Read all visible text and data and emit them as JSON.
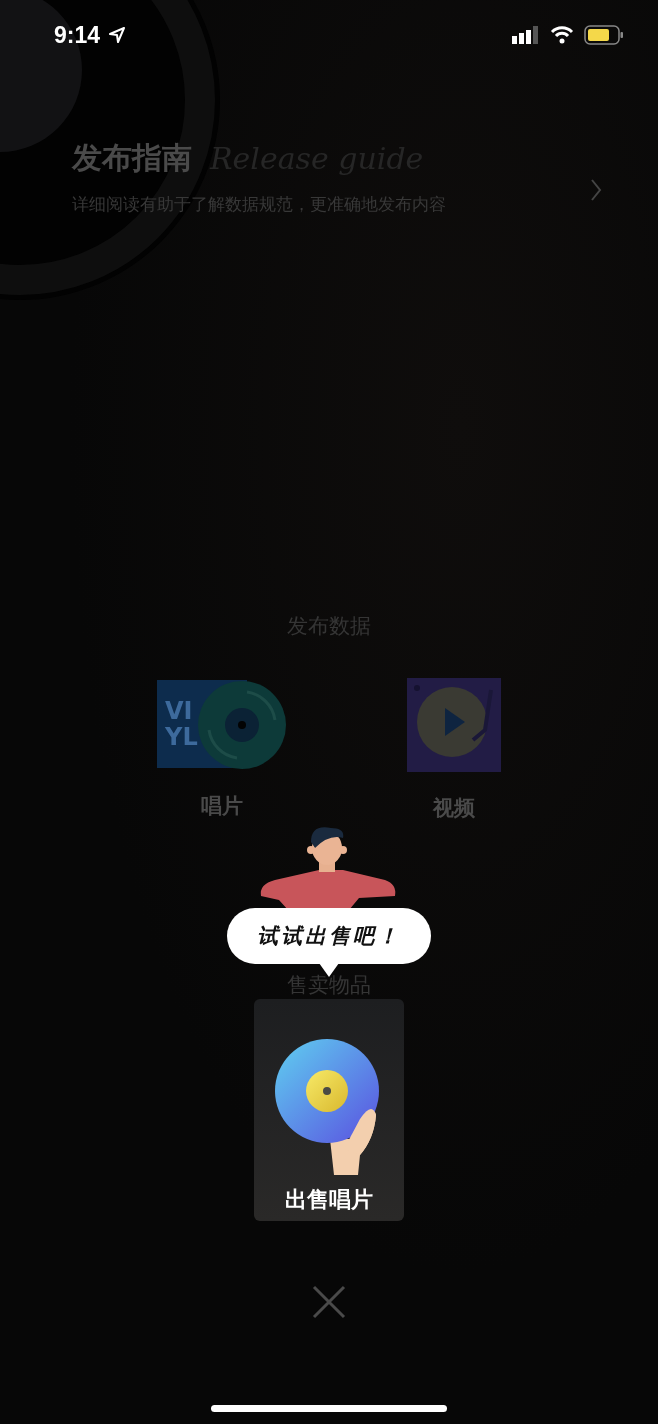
{
  "status_bar": {
    "time": "9:14"
  },
  "guide": {
    "title": "发布指南",
    "title_script": "Release guide",
    "description": "详细阅读有助于了解数据规范，更准确地发布内容"
  },
  "publish_data": {
    "title": "发布数据",
    "items": [
      {
        "kind": "record",
        "label": "唱片",
        "cover_lines": [
          "VI",
          "YL"
        ]
      },
      {
        "kind": "video",
        "label": "视频"
      }
    ]
  },
  "sell": {
    "title": "售卖物品",
    "tooltip": "试试出售吧！",
    "card": {
      "label": "出售唱片"
    }
  }
}
